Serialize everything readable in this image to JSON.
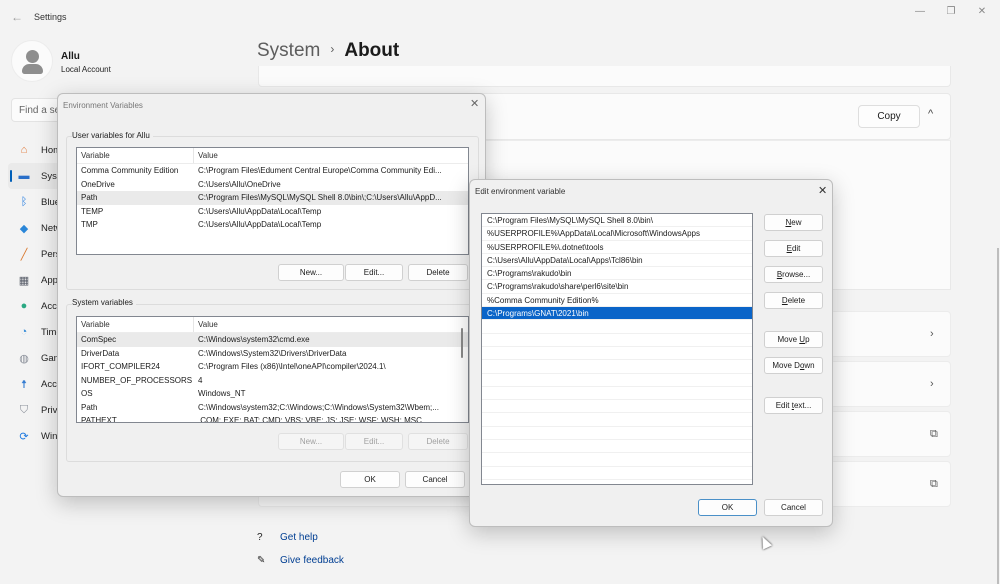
{
  "window": {
    "app_title": "Settings",
    "controls": {
      "minimize": "—",
      "maximize": "❐",
      "close": "✕"
    }
  },
  "profile": {
    "name": "Allu",
    "account_type": "Local Account"
  },
  "search": {
    "placeholder": "Find a setting"
  },
  "sidebar": {
    "items": [
      {
        "label": "Home",
        "icon": "home-icon",
        "glyph": "⌂",
        "color": "#e07a3a",
        "active": false
      },
      {
        "label": "System",
        "icon": "monitor-icon",
        "glyph": "▬",
        "color": "#2a6fc9",
        "active": true
      },
      {
        "label": "Bluetooth & devices",
        "icon": "bluetooth-icon",
        "glyph": "ᛒ",
        "color": "#1f7ae0",
        "active": false
      },
      {
        "label": "Network & internet",
        "icon": "wifi-icon",
        "glyph": "◆",
        "color": "#2a86d8",
        "active": false
      },
      {
        "label": "Personalization",
        "icon": "brush-icon",
        "glyph": "╱",
        "color": "#d9772c",
        "active": false
      },
      {
        "label": "Apps",
        "icon": "apps-icon",
        "glyph": "▦",
        "color": "#555a66",
        "active": false
      },
      {
        "label": "Accounts",
        "icon": "accounts-icon",
        "glyph": "●",
        "color": "#2aa882",
        "active": false
      },
      {
        "label": "Time & language",
        "icon": "globe-clock-icon",
        "glyph": "◔",
        "color": "#3a8ed8",
        "active": false
      },
      {
        "label": "Gaming",
        "icon": "gamepad-icon",
        "glyph": "◍",
        "color": "#8a8f99",
        "active": false
      },
      {
        "label": "Accessibility",
        "icon": "accessibility-icon",
        "glyph": "☨",
        "color": "#1a6ccc",
        "active": false
      },
      {
        "label": "Privacy & security",
        "icon": "shield-icon",
        "glyph": "⛉",
        "color": "#8a8f99",
        "active": false
      },
      {
        "label": "Windows Update",
        "icon": "update-icon",
        "glyph": "⟳",
        "color": "#1f7ae0",
        "active": false
      }
    ]
  },
  "main": {
    "breadcrumb": {
      "parent": "System",
      "separator": "›",
      "current": "About"
    },
    "copy_button": "Copy",
    "collapse_glyph": "^",
    "row_icons": [
      "›",
      "›",
      "⧉",
      "⧉"
    ],
    "help": [
      {
        "label": "Get help",
        "glyph": "?"
      },
      {
        "label": "Give feedback",
        "glyph": "✎"
      }
    ]
  },
  "env_dialog": {
    "title": "Environment Variables",
    "close": "✕",
    "user_group_label": "User variables for Allu",
    "columns": [
      "Variable",
      "Value"
    ],
    "user_vars": [
      {
        "name": "Comma Community Edition",
        "value": "C:\\Program Files\\Edument Central Europe\\Comma Community Edi...",
        "selected": false
      },
      {
        "name": "OneDrive",
        "value": "C:\\Users\\Allu\\OneDrive",
        "selected": false
      },
      {
        "name": "Path",
        "value": "C:\\Program Files\\MySQL\\MySQL Shell 8.0\\bin\\;C:\\Users\\Allu\\AppD...",
        "selected": true
      },
      {
        "name": "TEMP",
        "value": "C:\\Users\\Allu\\AppData\\Local\\Temp",
        "selected": false
      },
      {
        "name": "TMP",
        "value": "C:\\Users\\Allu\\AppData\\Local\\Temp",
        "selected": false
      }
    ],
    "user_buttons": {
      "new": "New...",
      "edit": "Edit...",
      "delete": "Delete"
    },
    "system_group_label": "System variables",
    "system_vars": [
      {
        "name": "ComSpec",
        "value": "C:\\Windows\\system32\\cmd.exe",
        "selected": true
      },
      {
        "name": "DriverData",
        "value": "C:\\Windows\\System32\\Drivers\\DriverData",
        "selected": false
      },
      {
        "name": "IFORT_COMPILER24",
        "value": "C:\\Program Files (x86)\\Intel\\oneAPI\\compiler\\2024.1\\",
        "selected": false
      },
      {
        "name": "NUMBER_OF_PROCESSORS",
        "value": "4",
        "selected": false
      },
      {
        "name": "OS",
        "value": "Windows_NT",
        "selected": false
      },
      {
        "name": "Path",
        "value": "C:\\Windows\\system32;C:\\Windows;C:\\Windows\\System32\\Wbem;...",
        "selected": false
      },
      {
        "name": "PATHEXT",
        "value": ".COM;.EXE;.BAT;.CMD;.VBS;.VBE;.JS;.JSE;.WSF;.WSH;.MSC",
        "selected": false
      }
    ],
    "system_buttons": {
      "new": "New...",
      "edit": "Edit...",
      "delete": "Delete"
    },
    "ok": "OK",
    "cancel": "Cancel"
  },
  "edit_dialog": {
    "title": "Edit environment variable",
    "close": "✕",
    "paths": [
      "C:\\Program Files\\MySQL\\MySQL Shell 8.0\\bin\\",
      "%USERPROFILE%\\AppData\\Local\\Microsoft\\WindowsApps",
      "%USERPROFILE%\\.dotnet\\tools",
      "C:\\Users\\Allu\\AppData\\Local\\Apps\\Tcl86\\bin",
      "C:\\Programs\\rakudo\\bin",
      "C:\\Programs\\rakudo\\share\\perl6\\site\\bin",
      "%Comma Community Edition%",
      "C:\\Programs\\GNAT\\2021\\bin"
    ],
    "selected_index": 7,
    "buttons": {
      "new": "New",
      "edit": "Edit",
      "browse": "Browse...",
      "delete": "Delete",
      "move_up": "Move Up",
      "move_down": "Move Down",
      "edit_text": "Edit text..."
    },
    "ok": "OK",
    "cancel": "Cancel"
  }
}
